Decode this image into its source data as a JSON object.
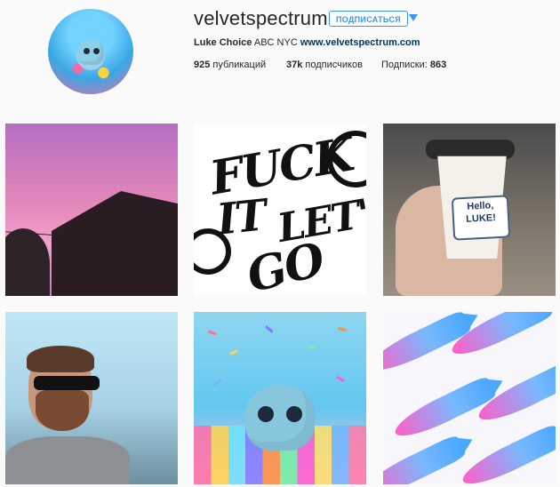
{
  "profile": {
    "username": "velvetspectrum",
    "follow_label": "ПОДПИСАТЬСЯ",
    "bio": {
      "name": "Luke Choice",
      "location": "ABC NYC",
      "website": "www.velvetspectrum.com"
    },
    "stats": {
      "posts_count": "925",
      "posts_label": "публикаций",
      "followers_count": "37k",
      "followers_label": "подписчиков",
      "following_label": "Подписки:",
      "following_count": "863"
    }
  },
  "posts": [
    {
      "label": ""
    },
    {
      "label": ""
    },
    {
      "label": "Hello, LUKE!"
    },
    {
      "label": ""
    },
    {
      "label": ""
    },
    {
      "label": ""
    }
  ],
  "colors": {
    "accent": "#3897f0",
    "link": "#003569",
    "background": "#fafafa",
    "text": "#262626"
  },
  "icons": {
    "follow_dropdown": "caret-down-icon",
    "avatar_image": "profile-photo"
  }
}
